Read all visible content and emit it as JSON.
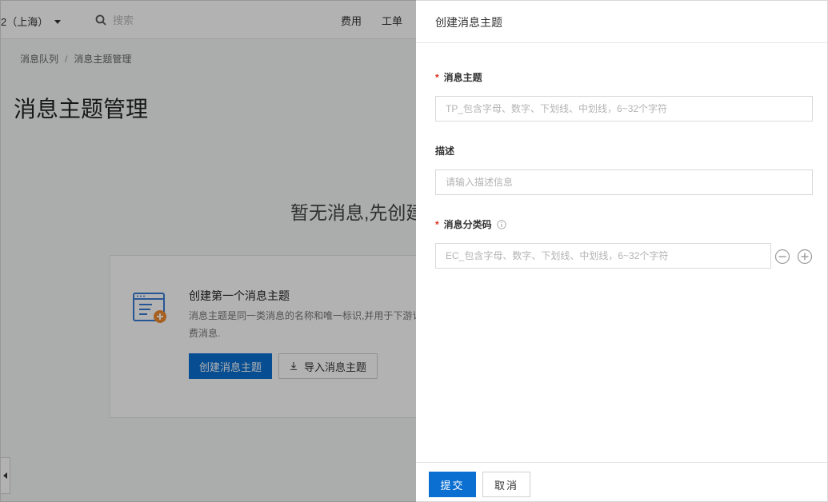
{
  "colors": {
    "primary": "#0a6fd1",
    "required": "#e0301e",
    "overlay": "rgba(0,0,0,0.30)"
  },
  "topbar": {
    "region": "2（上海）",
    "search_placeholder": "搜索",
    "nav": [
      "费用",
      "工单"
    ]
  },
  "breadcrumb": [
    "消息队列",
    "消息主题管理"
  ],
  "page": {
    "title": "消息主题管理",
    "empty_title": "暂无消息,先创建"
  },
  "card": {
    "title": "创建第一个消息主题",
    "description": "消息主题是同一类消息的名称和唯一标识,并用于下游订费消息.",
    "create_button": "创建消息主题",
    "import_button": "导入消息主题"
  },
  "drawer": {
    "title": "创建消息主题",
    "fields": {
      "topic": {
        "label": "消息主题",
        "required_mark": "*",
        "placeholder": "TP_包含字母、数字、下划线、中划线，6~32个字符",
        "value": ""
      },
      "description": {
        "label": "描述",
        "placeholder": "请输入描述信息",
        "value": ""
      },
      "category_code": {
        "label": "消息分类码",
        "required_mark": "*",
        "placeholder": "EC_包含字母、数字、下划线、中划线，6~32个字符",
        "value": ""
      }
    },
    "icons": {
      "info": "info-icon",
      "remove": "minus-circle-icon",
      "add": "plus-circle-icon"
    },
    "submit_button": "提交",
    "cancel_button": "取消"
  }
}
